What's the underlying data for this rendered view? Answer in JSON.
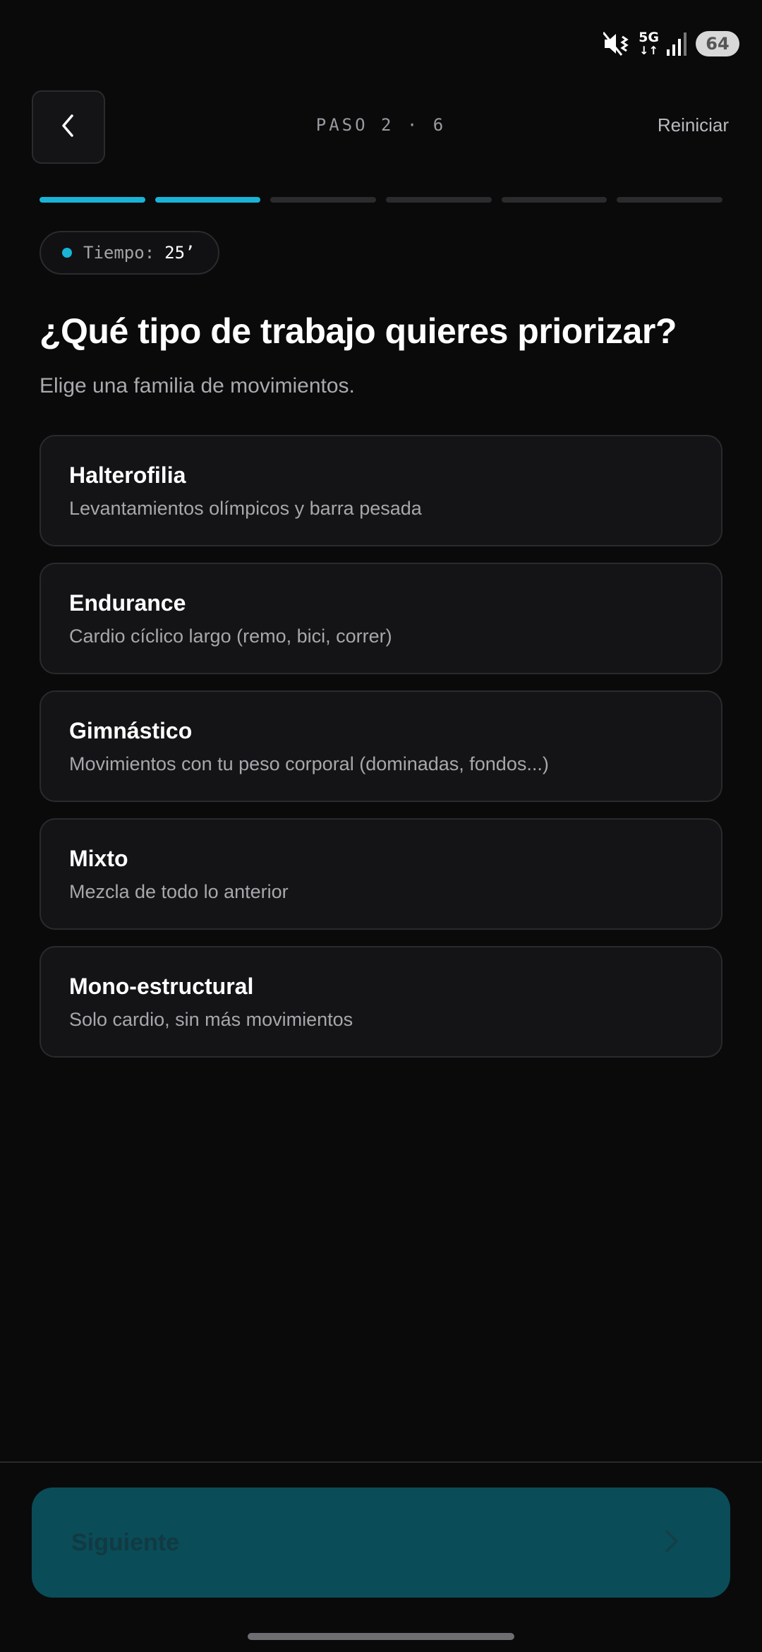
{
  "status_bar": {
    "network": "5G",
    "network_arrows": "↓↑",
    "battery": "64",
    "icons": [
      "mute-vibrate-icon",
      "signal-bars-icon",
      "battery-icon"
    ]
  },
  "header": {
    "step": "PASO 2 · 6",
    "reset": "Reiniciar"
  },
  "progress": {
    "current_step": 2,
    "total_steps": 6
  },
  "time_pill": {
    "label": "Tiempo:",
    "value": "25’"
  },
  "question": {
    "title": "¿Qué tipo de trabajo quieres priorizar?",
    "subtitle": "Elige una familia de movimientos."
  },
  "options": [
    {
      "title": "Halterofilia",
      "description": "Levantamientos olímpicos y barra pesada"
    },
    {
      "title": "Endurance",
      "description": "Cardio cíclico largo (remo, bici, correr)"
    },
    {
      "title": "Gimnástico",
      "description": "Movimientos con tu peso corporal (dominadas, fondos...)"
    },
    {
      "title": "Mixto",
      "description": "Mezcla de todo lo anterior"
    },
    {
      "title": "Mono-estructural",
      "description": "Solo cardio, sin más movimientos"
    }
  ],
  "footer": {
    "next": "Siguiente"
  },
  "colors": {
    "background": "#0a0a0b",
    "accent": "#19b3d7",
    "card": "#141416",
    "next_button": "#0a4c58"
  }
}
